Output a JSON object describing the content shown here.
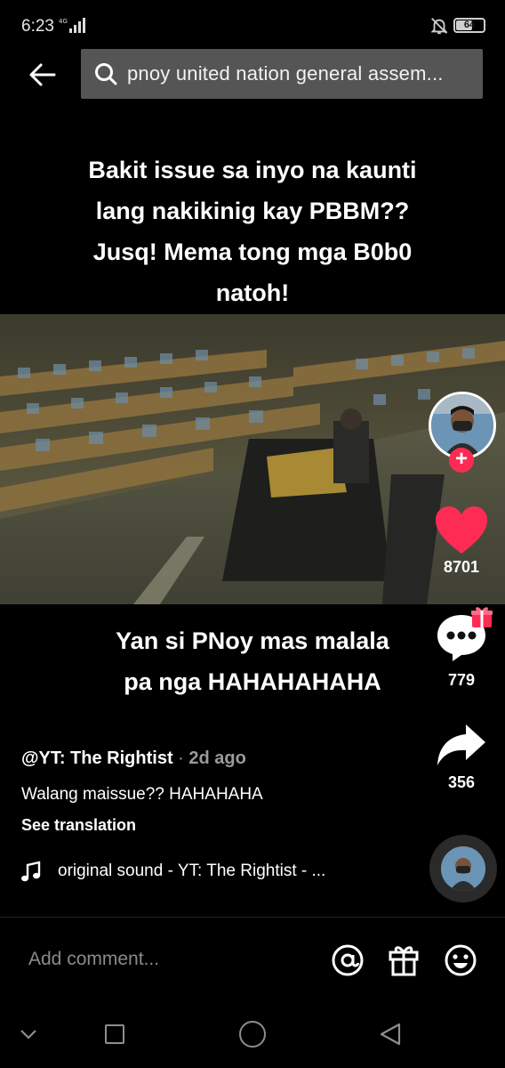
{
  "status_bar": {
    "time": "6:23",
    "battery_level": "64"
  },
  "search": {
    "query": "pnoy united nation general assem..."
  },
  "video": {
    "caption_top": "Bakit issue sa inyo na kaunti lang nakikinig kay PBBM?? Jusq! Mema tong mga B0b0 natoh!",
    "caption_bottom_line1": "Yan si PNoy mas malala",
    "caption_bottom_line2": "pa nga HAHAHAHAHA"
  },
  "actions": {
    "like_count": "8701",
    "comment_count": "779",
    "share_count": "356"
  },
  "post": {
    "author": "@YT: The Rightist",
    "separator": " · ",
    "age": "2d ago",
    "description": "Walang maissue?? HAHAHAHA",
    "see_translation": "See translation",
    "sound": "original sound - YT: The Rightist - ..."
  },
  "comment_bar": {
    "placeholder": "Add comment..."
  },
  "icons": {
    "back": "arrow-left-icon",
    "search": "search-icon",
    "like": "heart-icon",
    "comment": "speech-bubble-icon",
    "share": "share-arrow-icon",
    "music": "music-note-icon",
    "mention": "at-sign-icon",
    "gift": "gift-icon",
    "emoji": "smiley-icon"
  },
  "colors": {
    "accent": "#fe2c55",
    "background": "#000000",
    "search_bg": "#555555"
  }
}
